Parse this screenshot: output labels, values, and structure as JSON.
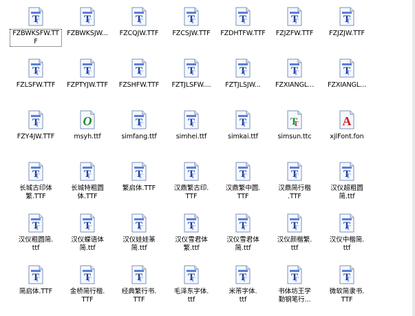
{
  "colors": {
    "tt_glyph": "#1a3b99",
    "tt_stripe": "#5b7fd6",
    "doc_border": "#7a90b8",
    "doc_fill": "#f5f8ff"
  },
  "files": [
    {
      "label": "FZBWKSFW.TTF",
      "type": "truetype",
      "selected": true,
      "label_lines": "FZBWKSFW.TT\nF"
    },
    {
      "label": "FZBWKSJW...",
      "type": "truetype"
    },
    {
      "label": "FZCQJW.TTF",
      "type": "truetype"
    },
    {
      "label": "FZCSJW.TTF",
      "type": "truetype"
    },
    {
      "label": "FZDHTFW.TTF",
      "type": "truetype"
    },
    {
      "label": "FZJZFW.TTF",
      "type": "truetype"
    },
    {
      "label": "FZJZJW.TTF",
      "type": "truetype"
    },
    {
      "label": "FZLSFW.TTF",
      "type": "truetype"
    },
    {
      "label": "FZPTYJW.TTF",
      "type": "truetype"
    },
    {
      "label": "FZSHFW.TTF",
      "type": "truetype"
    },
    {
      "label": "FZTJLSFW....",
      "type": "truetype"
    },
    {
      "label": "FZTJLSJW...",
      "type": "truetype"
    },
    {
      "label": "FZXIANGL...",
      "type": "truetype"
    },
    {
      "label": "FZXIANGL...",
      "type": "truetype"
    },
    {
      "label": "FZY4JW.TTF",
      "type": "truetype"
    },
    {
      "label": "msyh.ttf",
      "type": "opentype"
    },
    {
      "label": "simfang.ttf",
      "type": "truetype"
    },
    {
      "label": "simhei.ttf",
      "type": "truetype"
    },
    {
      "label": "simkai.ttf",
      "type": "truetype"
    },
    {
      "label": "simsun.ttc",
      "type": "collection"
    },
    {
      "label": "xjlFont.fon",
      "type": "raster"
    },
    {
      "label": "长城古印体\n繁.TTF",
      "type": "truetype"
    },
    {
      "label": "长城特粗圆\n体.TTF",
      "type": "truetype"
    },
    {
      "label": "繁启体.TTF",
      "type": "truetype"
    },
    {
      "label": "汉鼎繁古印.\nTTF",
      "type": "truetype"
    },
    {
      "label": "汉鼎繁中圆.\nTTF",
      "type": "truetype"
    },
    {
      "label": "汉鼎简行楷\n.TTF",
      "type": "truetype"
    },
    {
      "label": "汉仪超粗圆\n简.ttf",
      "type": "truetype"
    },
    {
      "label": "汉仪粗圆简.\nttf",
      "type": "truetype"
    },
    {
      "label": "汉仪蝶语体\n简.ttf",
      "type": "truetype"
    },
    {
      "label": "汉仪娃娃篆\n简.ttf",
      "type": "truetype"
    },
    {
      "label": "汉仪雪君体\n繁.ttf",
      "type": "truetype"
    },
    {
      "label": "汉仪雪君体\n简.ttf",
      "type": "truetype"
    },
    {
      "label": "汉仪颜楷繁.\nttf",
      "type": "truetype"
    },
    {
      "label": "汉仪中楷简.\nttf",
      "type": "truetype"
    },
    {
      "label": "简启体.TTF",
      "type": "truetype"
    },
    {
      "label": "金桥简行楷.\nTTF",
      "type": "truetype"
    },
    {
      "label": "经典繁行书.\nTTF",
      "type": "truetype"
    },
    {
      "label": "毛泽东字体.\nttf",
      "type": "truetype"
    },
    {
      "label": "米芾字体.\nttf",
      "type": "truetype"
    },
    {
      "label": "书体坊王学\n勤钢笔行...",
      "type": "truetype"
    },
    {
      "label": "微软简隶书.\nTTF",
      "type": "truetype"
    }
  ]
}
